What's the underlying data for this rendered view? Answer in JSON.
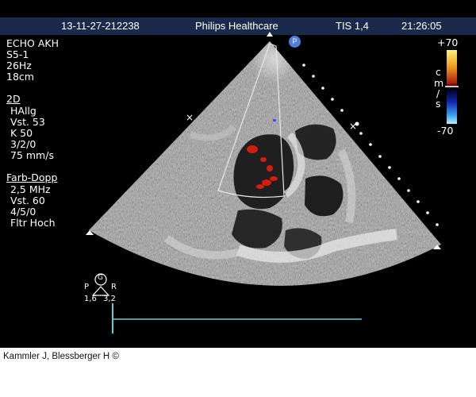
{
  "header": {
    "date_id": "13-11-27-212238",
    "brand": "Philips Healthcare",
    "tis": "TIS 1,4",
    "time": "21:26:05"
  },
  "probe_info": {
    "preset": "ECHO AKH",
    "transducer": "S5-1",
    "frame_rate": "26Hz",
    "depth": "18cm"
  },
  "mode_2d": {
    "title": "2D",
    "lines": [
      "HAllg",
      "Vst. 53",
      "K 50",
      "3/2/0",
      "75 mm/s"
    ]
  },
  "color_doppler": {
    "title": "Farb-Dopp",
    "lines": [
      "2,5 MHz",
      "Vst. 60",
      "4/5/0",
      "Fltr Hoch"
    ]
  },
  "color_scale": {
    "max": "+70",
    "min": "-70",
    "unit_chars": [
      "c",
      "m",
      "/",
      "s"
    ]
  },
  "markers": {
    "probe_badge": "P",
    "orientation_badge": "G",
    "left_letter": "P",
    "right_letter": "R",
    "left_value": "1,6",
    "right_value": "3,2"
  },
  "footer": {
    "credit": "Kammler J, Blessberger H ©"
  },
  "colors": {
    "header_bg": "#1a2a4a",
    "scan_bg": "#000000",
    "roi_line": "#e8e8e8",
    "timeline": "#5fd0d8",
    "doppler_red": "#d41c10"
  }
}
